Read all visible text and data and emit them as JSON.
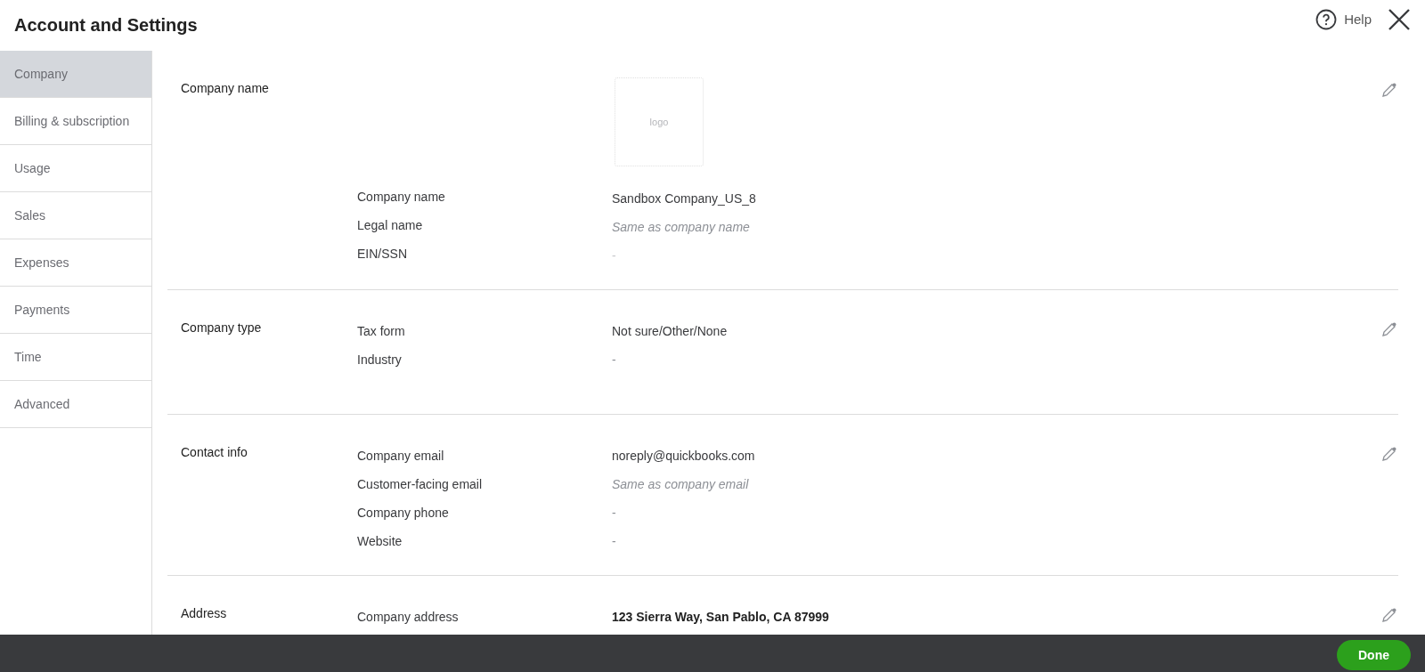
{
  "window": {
    "title": "Account and Settings"
  },
  "header": {
    "help": "Help"
  },
  "sidebar": {
    "items": [
      {
        "label": "Company",
        "selected": true
      },
      {
        "label": "Billing & subscription",
        "selected": false
      },
      {
        "label": "Usage",
        "selected": false
      },
      {
        "label": "Sales",
        "selected": false
      },
      {
        "label": "Expenses",
        "selected": false
      },
      {
        "label": "Payments",
        "selected": false
      },
      {
        "label": "Time",
        "selected": false
      },
      {
        "label": "Advanced",
        "selected": false
      }
    ]
  },
  "sections": [
    {
      "heading": "Company name",
      "logo": "logo",
      "rows": [
        {
          "label": "Company name",
          "value": "Sandbox Company_US_8",
          "kind": "plain"
        },
        {
          "label": "Legal name",
          "value": "Same as company name",
          "kind": "placeholder"
        },
        {
          "label": "EIN/SSN",
          "value": "-",
          "kind": "faint"
        }
      ]
    },
    {
      "heading": "Company type",
      "rows": [
        {
          "label": "Tax form",
          "value": "Not sure/Other/None",
          "kind": "plain"
        },
        {
          "label": "Industry",
          "value": "-",
          "kind": "empty"
        }
      ]
    },
    {
      "heading": "Contact info",
      "rows": [
        {
          "label": "Company email",
          "value": "noreply@quickbooks.com",
          "kind": "plain"
        },
        {
          "label": "Customer-facing email",
          "value": "Same as company email",
          "kind": "placeholder"
        },
        {
          "label": "Company phone",
          "value": "-",
          "kind": "empty"
        },
        {
          "label": "Website",
          "value": "-",
          "kind": "empty"
        }
      ]
    },
    {
      "heading": "Address",
      "rows": [
        {
          "label": "Company address",
          "value": "123 Sierra Way, San Pablo, CA 87999",
          "kind": "bold"
        }
      ]
    }
  ],
  "footer": {
    "done": "Done"
  }
}
